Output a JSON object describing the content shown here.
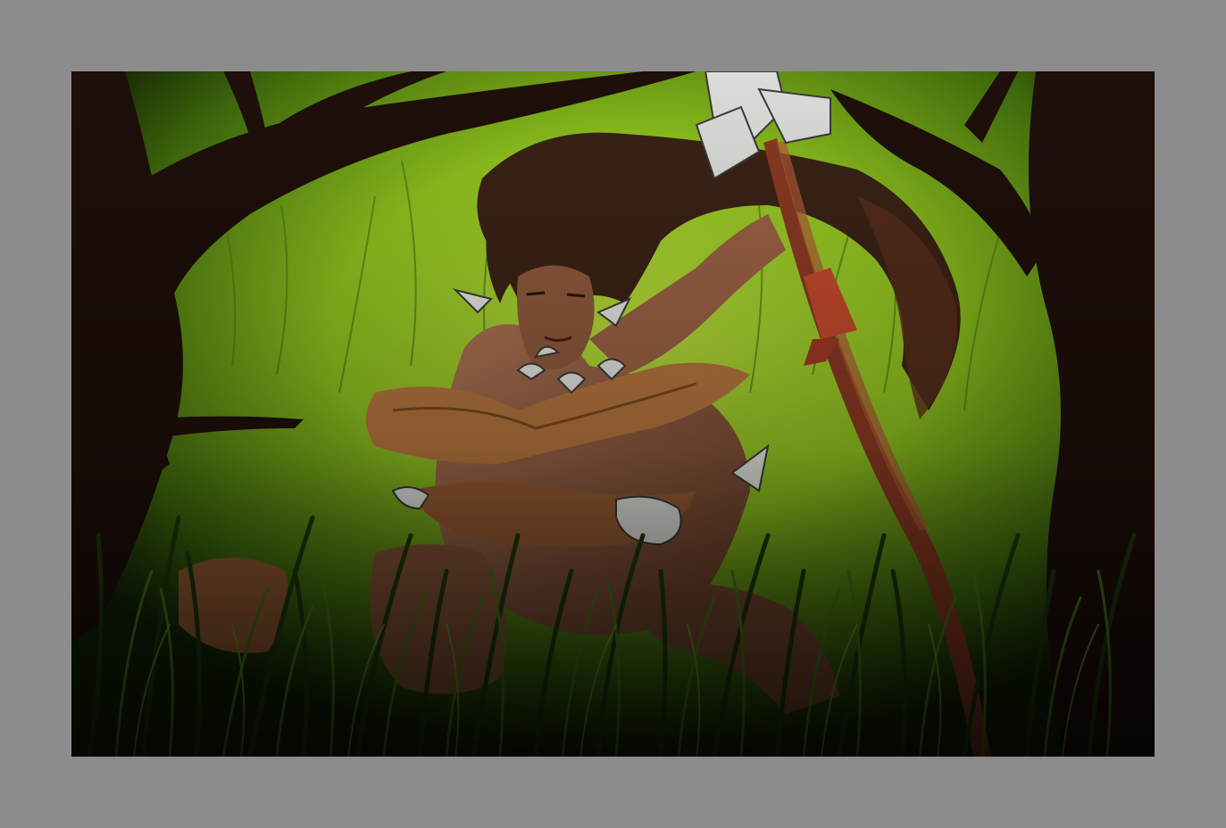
{
  "colors": {
    "frame": "#8c8c8c",
    "background_glow": "#a9d22e",
    "background_dark": "#1a2a08",
    "tree": "#1e0f0a",
    "hair": "#3b2216",
    "skin": "#a0684a",
    "fur": "#b8763f",
    "bone": "#e6e6e0",
    "spear": "#8a3a22",
    "grass_light": "#5a8a20",
    "grass_dark": "#152808"
  },
  "artwork": {
    "subject": "huntress-with-spear-in-tall-grass"
  }
}
